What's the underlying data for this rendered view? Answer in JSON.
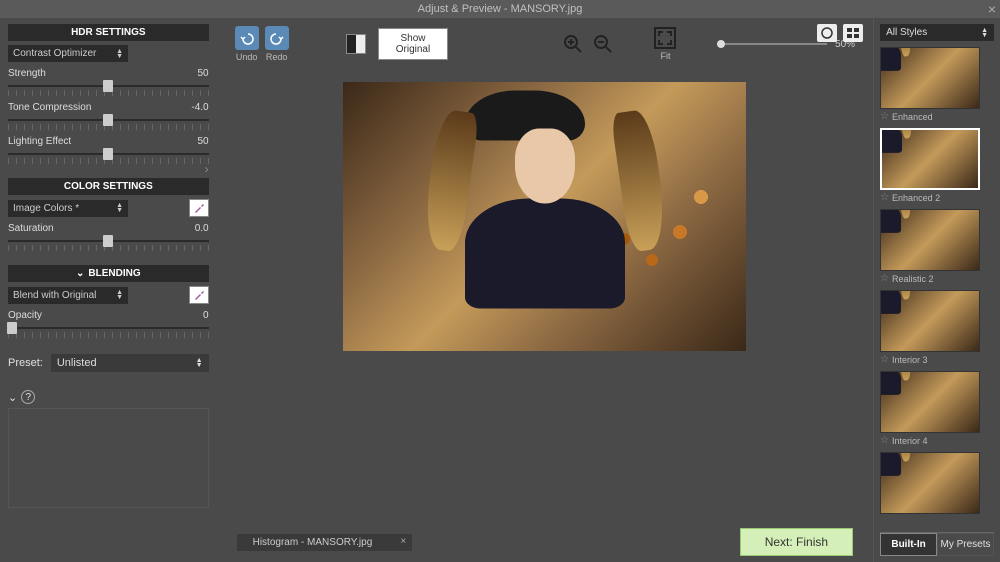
{
  "titlebar": {
    "text": "Adjust & Preview - MANSORY.jpg"
  },
  "hdr": {
    "header": "HDR SETTINGS",
    "method": "Contrast Optimizer",
    "sliders": [
      {
        "label": "Strength",
        "value": "50",
        "pos": 50
      },
      {
        "label": "Tone Compression",
        "value": "-4.0",
        "pos": 50
      },
      {
        "label": "Lighting Effect",
        "value": "50",
        "pos": 50
      }
    ]
  },
  "color": {
    "header": "COLOR SETTINGS",
    "method": "Image Colors *",
    "sliders": [
      {
        "label": "Saturation",
        "value": "0.0",
        "pos": 50
      }
    ]
  },
  "blending": {
    "header": "BLENDING",
    "method": "Blend with Original",
    "sliders": [
      {
        "label": "Opacity",
        "value": "0",
        "pos": 2
      }
    ]
  },
  "preset": {
    "label": "Preset:",
    "value": "Unlisted"
  },
  "toolbar": {
    "undo": "Undo",
    "redo": "Redo",
    "show_original": "Show Original",
    "fit": "Fit",
    "zoom_value": "50%"
  },
  "next_button": "Next: Finish",
  "histogram_tab": "Histogram - MANSORY.jpg",
  "styles": {
    "dropdown": "All Styles",
    "thumbs": [
      {
        "label": "Enhanced",
        "selected": false
      },
      {
        "label": "Enhanced 2",
        "selected": true
      },
      {
        "label": "Realistic 2",
        "selected": false
      },
      {
        "label": "Interior 3",
        "selected": false
      },
      {
        "label": "Interior 4",
        "selected": false
      },
      {
        "label": "",
        "selected": false
      }
    ],
    "tabs": {
      "builtin": "Built-In",
      "mypresets": "My Presets"
    }
  }
}
